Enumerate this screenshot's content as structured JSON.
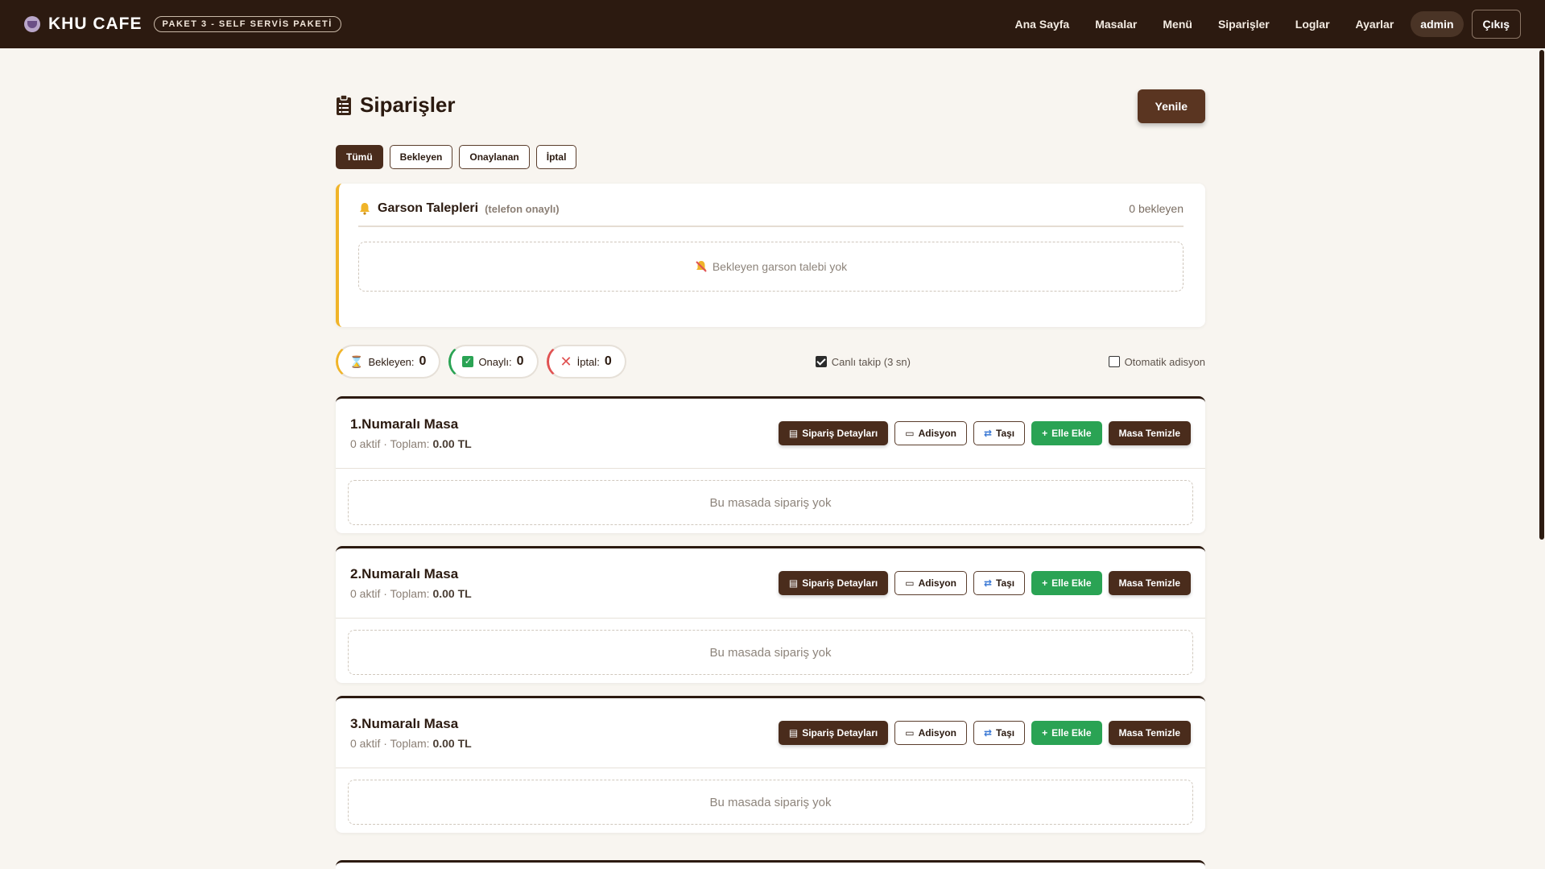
{
  "nav": {
    "brand": "KHU CAFE",
    "badge": "PAKET 3 - SELF SERVİS PAKETİ",
    "links": [
      "Ana Sayfa",
      "Masalar",
      "Menü",
      "Siparişler",
      "Loglar",
      "Ayarlar"
    ],
    "user": "admin",
    "logout": "Çıkış"
  },
  "page": {
    "title": "Siparişler",
    "refresh": "Yenile",
    "filters": [
      "Tümü",
      "Bekleyen",
      "Onaylanan",
      "İptal"
    ]
  },
  "waiter": {
    "title": "Garson Talepleri",
    "subtitle": "(telefon onaylı)",
    "count": "0 bekleyen",
    "empty": "Bekleyen garson talebi yok"
  },
  "stats": {
    "pending_label": "Bekleyen:",
    "pending_value": "0",
    "approved_label": "Onaylı:",
    "approved_value": "0",
    "cancel_label": "İptal:",
    "cancel_value": "0",
    "live_label": "Canlı takip (3 sn)",
    "live_checked": true,
    "auto_label": "Otomatik adisyon",
    "auto_checked": false
  },
  "actions": {
    "details": "Sipariş Detayları",
    "bill": "Adisyon",
    "move": "Taşı",
    "add": "Elle Ekle",
    "clean": "Masa Temizle"
  },
  "tables": [
    {
      "name": "1.Numaralı Masa",
      "meta_prefix": "0 aktif · Toplam:",
      "total": "0.00 TL",
      "empty": "Bu masada sipariş yok"
    },
    {
      "name": "2.Numaralı Masa",
      "meta_prefix": "0 aktif · Toplam:",
      "total": "0.00 TL",
      "empty": "Bu masada sipariş yok"
    },
    {
      "name": "3.Numaralı Masa",
      "meta_prefix": "0 aktif · Toplam:",
      "total": "0.00 TL",
      "empty": "Bu masada sipariş yok"
    }
  ],
  "colors": {
    "nav_bg": "#2c1a10",
    "accent_dark": "#4a2c1c",
    "green": "#2aa354",
    "warning": "#f0b429",
    "danger": "#e05252"
  }
}
